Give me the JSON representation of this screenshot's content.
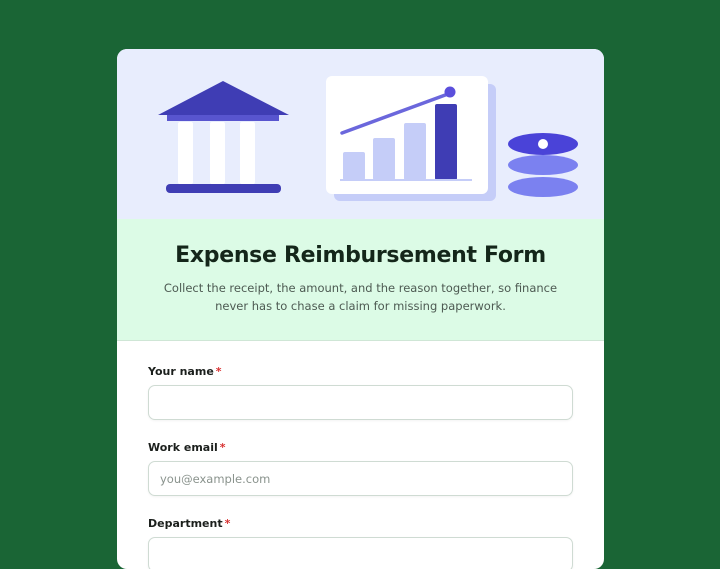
{
  "form": {
    "title": "Expense Reimbursement Form",
    "description": "Collect the receipt, the amount, and the reason together, so finance never has to chase a claim for missing paperwork.",
    "required_marker": "*",
    "fields": [
      {
        "label": "Your name",
        "value": "",
        "placeholder": ""
      },
      {
        "label": "Work email",
        "value": "",
        "placeholder": "you@example.com"
      },
      {
        "label": "Department",
        "value": "",
        "placeholder": ""
      }
    ]
  },
  "hero": {
    "icons": [
      "bank-icon",
      "bar-chart-icon",
      "coin-stack-icon"
    ],
    "colors": {
      "background": "#e8edfd",
      "primary": "#3f3db4",
      "accent": "#5b4fdc",
      "muted": "#c5cdf8"
    }
  },
  "colors": {
    "page_background": "#1a6535",
    "intro_background": "#dcfbe6",
    "required": "#d83232"
  }
}
